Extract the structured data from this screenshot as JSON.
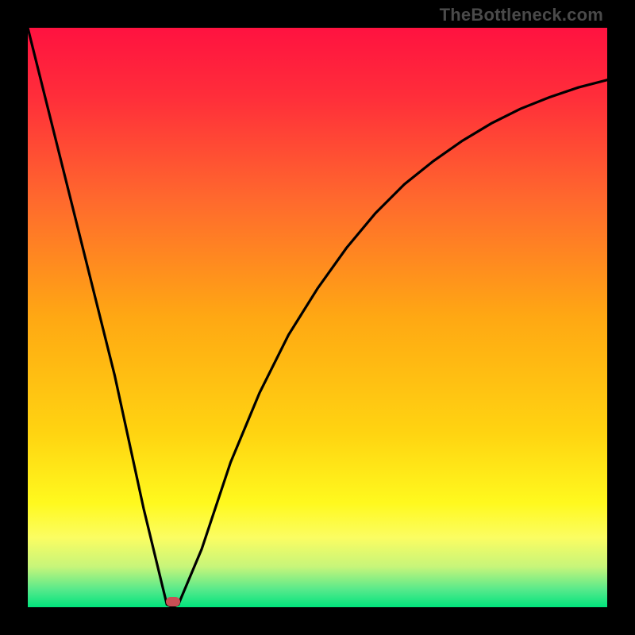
{
  "watermark": "TheBottleneck.com",
  "chart_data": {
    "type": "line",
    "title": "",
    "xlabel": "",
    "ylabel": "",
    "xlim": [
      0,
      100
    ],
    "ylim": [
      0,
      100
    ],
    "grid": false,
    "legend": false,
    "series": [
      {
        "name": "bottleneck-curve",
        "color": "#000000",
        "x": [
          0,
          5,
          10,
          15,
          20,
          24,
          25,
          26,
          30,
          35,
          40,
          45,
          50,
          55,
          60,
          65,
          70,
          75,
          80,
          85,
          90,
          95,
          100
        ],
        "values": [
          100,
          80,
          60,
          40,
          17,
          0.5,
          0,
          0.5,
          10,
          25,
          37,
          47,
          55,
          62,
          68,
          73,
          77,
          80.5,
          83.5,
          86,
          88,
          89.7,
          91
        ]
      }
    ],
    "annotations": [
      {
        "name": "minimum-marker",
        "shape": "pill",
        "x": 25,
        "y": 1,
        "color": "#c94f55"
      }
    ],
    "background_gradient_stops": [
      {
        "offset": 0.0,
        "color": "#ff1240"
      },
      {
        "offset": 0.12,
        "color": "#ff2e3a"
      },
      {
        "offset": 0.3,
        "color": "#ff6a2d"
      },
      {
        "offset": 0.5,
        "color": "#ffa813"
      },
      {
        "offset": 0.7,
        "color": "#ffd411"
      },
      {
        "offset": 0.82,
        "color": "#fff91e"
      },
      {
        "offset": 0.88,
        "color": "#fbfd62"
      },
      {
        "offset": 0.93,
        "color": "#c7f57a"
      },
      {
        "offset": 0.97,
        "color": "#56e98b"
      },
      {
        "offset": 1.0,
        "color": "#00e47d"
      }
    ]
  }
}
